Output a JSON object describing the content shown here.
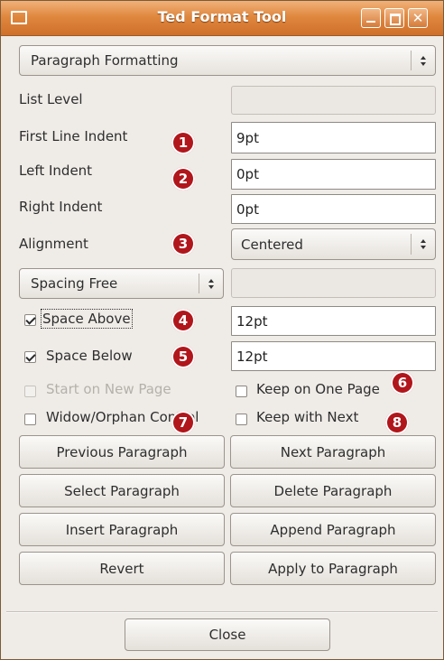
{
  "window": {
    "title": "Ted Format Tool"
  },
  "page_selector": {
    "value": "Paragraph Formatting"
  },
  "fields": {
    "list_level": {
      "label": "List Level",
      "value": ""
    },
    "first_line_indent": {
      "label": "First Line Indent",
      "value": "9pt"
    },
    "left_indent": {
      "label": "Left Indent",
      "value": "0pt"
    },
    "right_indent": {
      "label": "Right Indent",
      "value": "0pt"
    },
    "alignment": {
      "label": "Alignment",
      "value": "Centered"
    },
    "spacing": {
      "value": "Spacing Free",
      "entry": ""
    },
    "space_above": {
      "label": "Space Above",
      "value": "12pt",
      "checked": true
    },
    "space_below": {
      "label": "Space Below",
      "value": "12pt",
      "checked": true
    }
  },
  "options": {
    "start_on_new_page": {
      "label": "Start on New Page",
      "checked": false,
      "disabled": true
    },
    "keep_on_one_page": {
      "label": "Keep on One Page",
      "checked": false
    },
    "widow_orphan_control": {
      "label": "Widow/Orphan Control",
      "checked": false
    },
    "keep_with_next": {
      "label": "Keep with Next",
      "checked": false
    }
  },
  "buttons": {
    "previous_paragraph": "Previous Paragraph",
    "next_paragraph": "Next Paragraph",
    "select_paragraph": "Select Paragraph",
    "delete_paragraph": "Delete Paragraph",
    "insert_paragraph": "Insert Paragraph",
    "append_paragraph": "Append Paragraph",
    "revert": "Revert",
    "apply_to_paragraph": "Apply to Paragraph",
    "close": "Close"
  },
  "callouts": [
    "1",
    "2",
    "3",
    "4",
    "5",
    "6",
    "7",
    "8"
  ],
  "colors": {
    "titlebar": "#e0883f",
    "callout": "#b0161b",
    "window_bg": "#efebe7"
  }
}
